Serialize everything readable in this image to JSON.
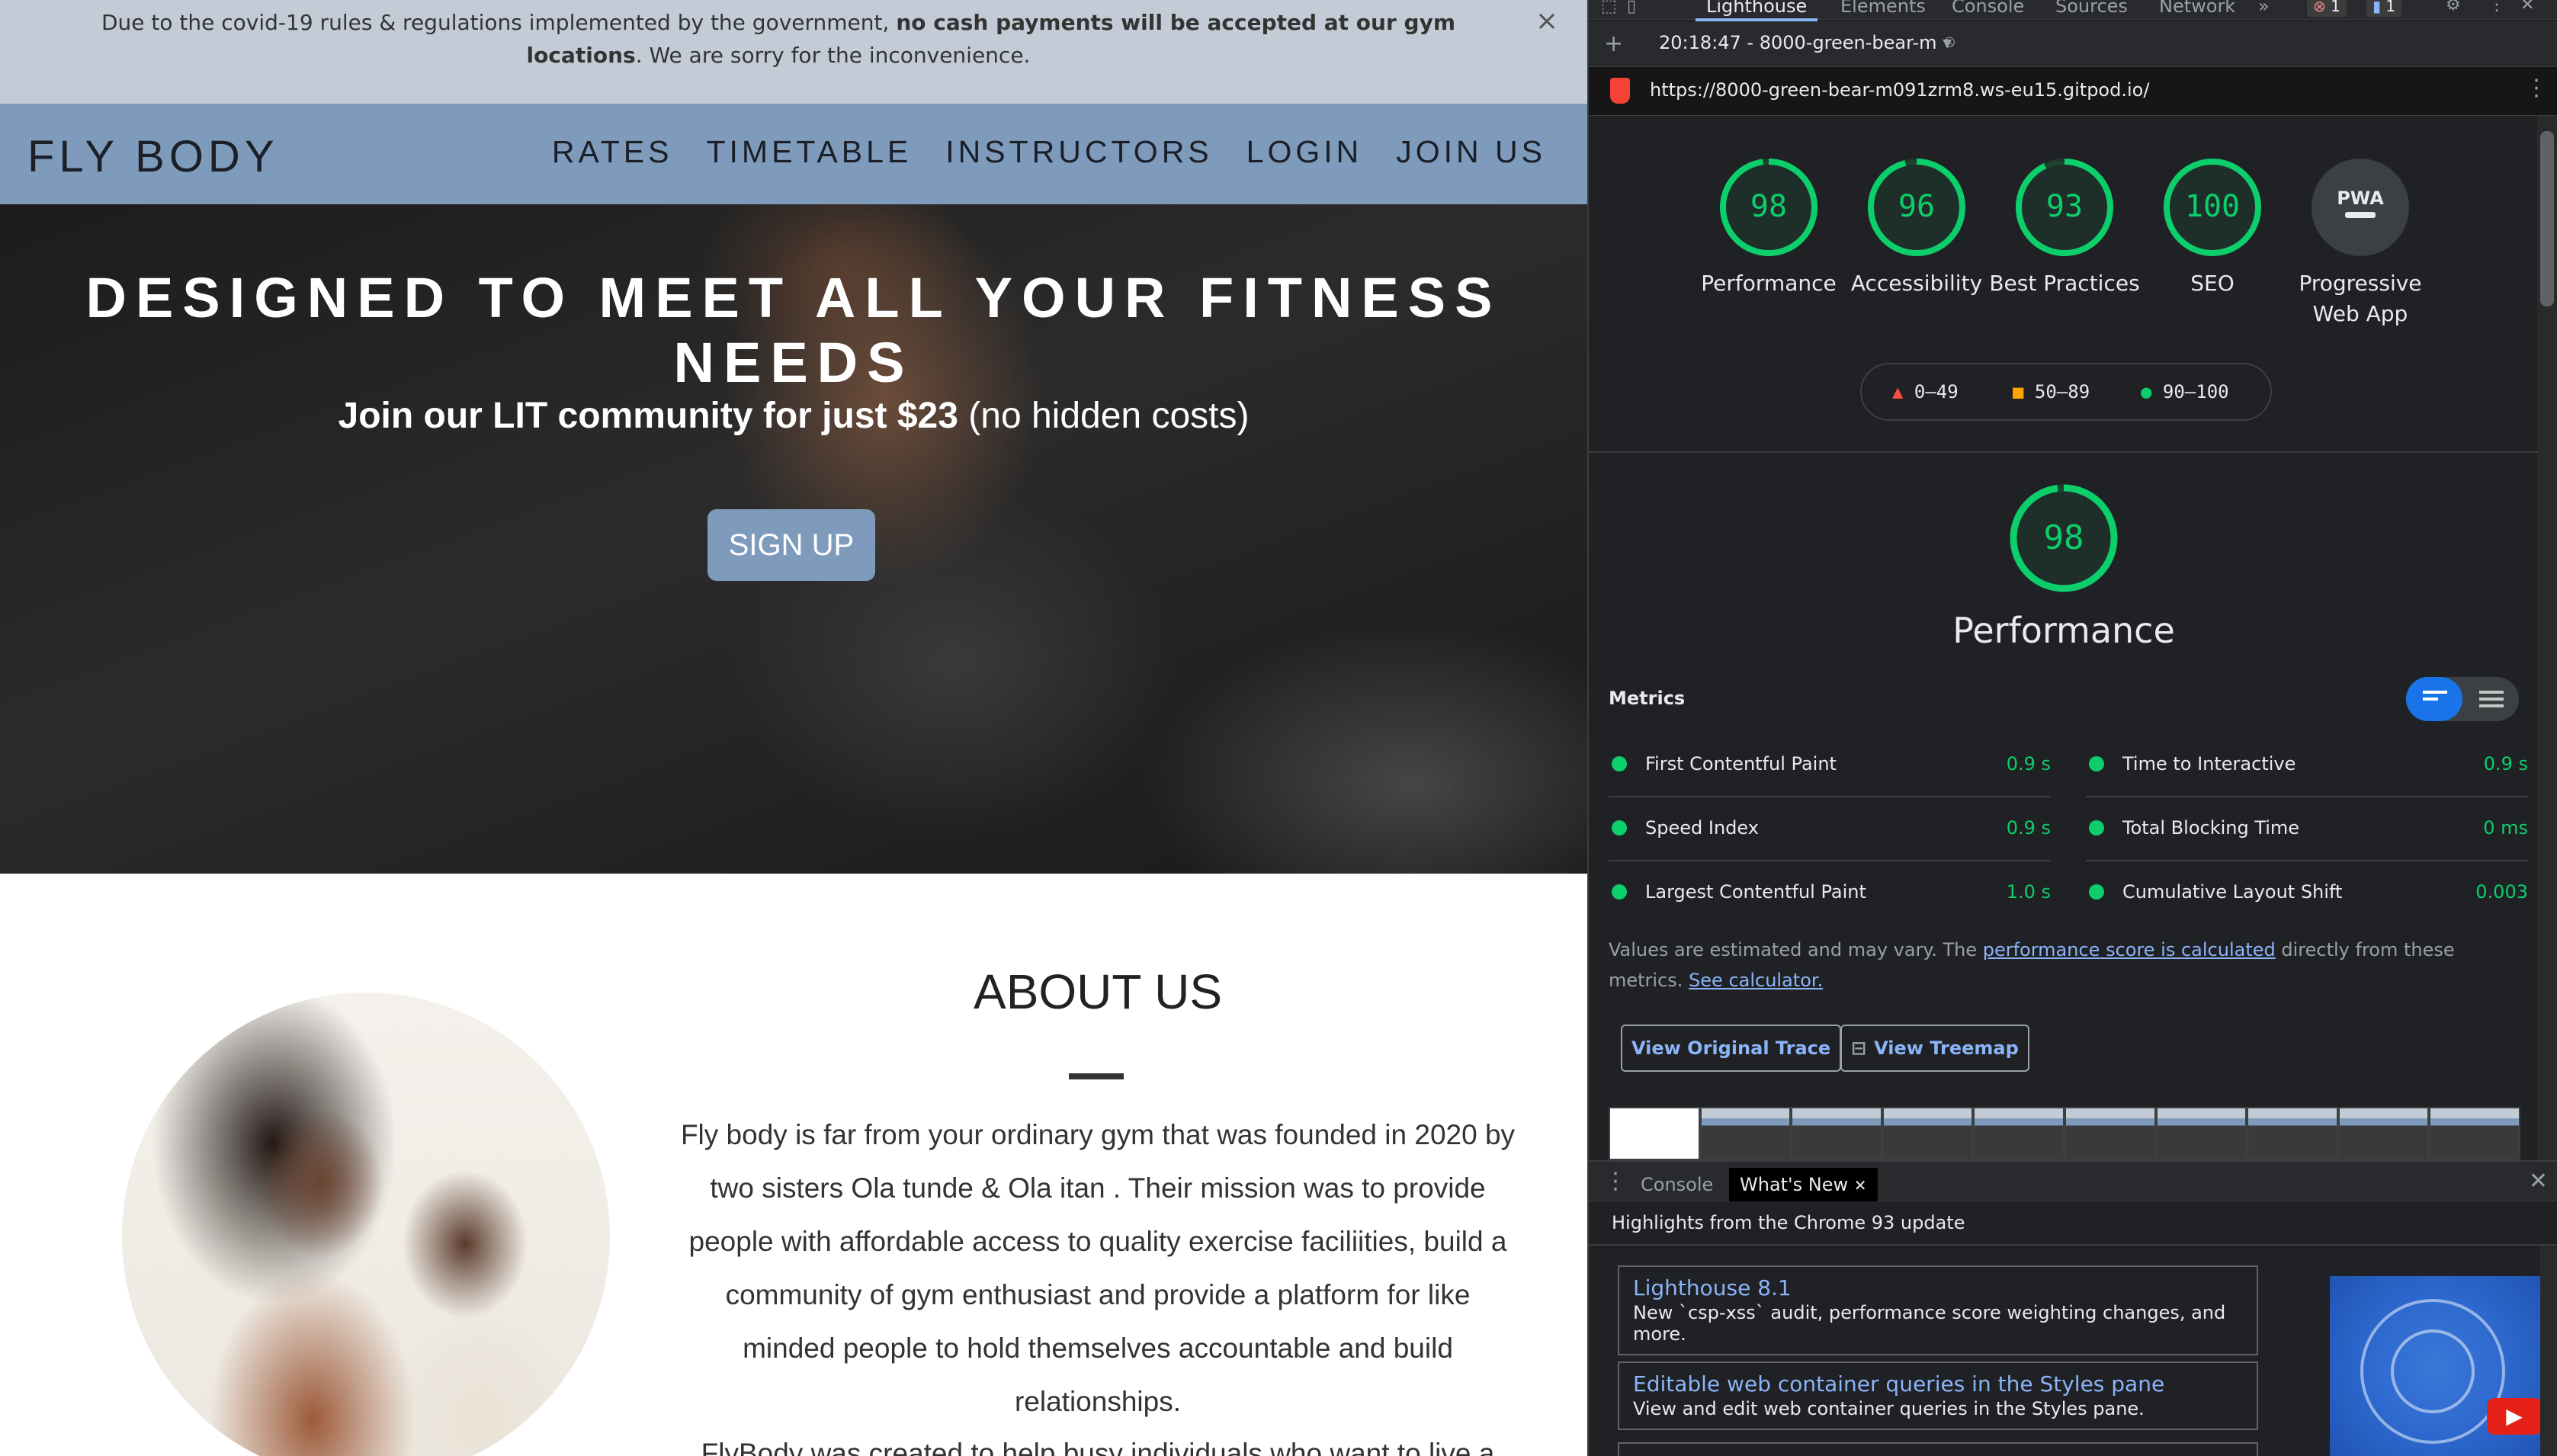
{
  "site": {
    "banner": {
      "text_before": "Due to the covid-19 rules & regulations implemented by the government, ",
      "text_bold": "no cash payments will be accepted at our gym locations",
      "text_after": ". We are sorry for the inconvenience.",
      "close_label": "×"
    },
    "nav": {
      "brand": "FLY BODY",
      "links": [
        "RATES",
        "TIMETABLE",
        "INSTRUCTORS",
        "LOGIN",
        "JOIN US"
      ]
    },
    "hero": {
      "title": "DESIGNED TO MEET ALL YOUR FITNESS NEEDS",
      "subtitle_bold": "Join our LIT community for just $23",
      "subtitle_rest": " (no hidden costs)",
      "cta": "SIGN UP"
    },
    "about": {
      "title": "ABOUT US",
      "paragraph1": "Fly body is far from your ordinary gym that was founded in 2020 by two sisters Ola tunde & Ola itan . Their mission was to provide people with affordable access to quality exercise faciliities, build a community of gym enthusiast and provide a platform for like minded people to hold themselves accountable and build relationships.",
      "paragraph2": "FlyBody was created to help busy individuals who want to live a"
    }
  },
  "devtools": {
    "tabs": [
      "Lighthouse",
      "Elements",
      "Console",
      "Sources",
      "Network"
    ],
    "more_tabs": "»",
    "error_count": "1",
    "message_count": "1",
    "report_select": "20:18:47 - 8000-green-bear-m",
    "url": "https://8000-green-bear-m091zrm8.ws-eu15.gitpod.io/",
    "categories": [
      {
        "label": "Performance",
        "score": "98",
        "fraction": 0.98
      },
      {
        "label": "Accessibility",
        "score": "96",
        "fraction": 0.96
      },
      {
        "label": "Best Practices",
        "score": "93",
        "fraction": 0.93
      },
      {
        "label": "SEO",
        "score": "100",
        "fraction": 1.0
      },
      {
        "label": "Progressive Web App",
        "score": "PWA",
        "fraction": 0
      }
    ],
    "legend": {
      "fail": "0–49",
      "average": "50–89",
      "pass": "90–100"
    },
    "performance": {
      "score": "98",
      "fraction": 0.98,
      "title": "Performance"
    },
    "metrics_title": "Metrics",
    "metrics": [
      {
        "name": "First Contentful Paint",
        "value": "0.9 s"
      },
      {
        "name": "Time to Interactive",
        "value": "0.9 s"
      },
      {
        "name": "Speed Index",
        "value": "0.9 s"
      },
      {
        "name": "Total Blocking Time",
        "value": "0 ms"
      },
      {
        "name": "Largest Contentful Paint",
        "value": "1.0 s"
      },
      {
        "name": "Cumulative Layout Shift",
        "value": "0.003"
      }
    ],
    "disclaimer": {
      "text1": "Values are estimated and may vary. The ",
      "link1": "performance score is calculated",
      "text2": " directly from these metrics. ",
      "link2": "See calculator."
    },
    "buttons": {
      "trace": "View Original Trace",
      "treemap": "View Treemap"
    },
    "drawer": {
      "tabs": [
        "Console",
        "What's New"
      ],
      "subtitle": "Highlights from the Chrome 93 update",
      "news": [
        {
          "title": "Lighthouse 8.1",
          "desc": "New `csp-xss` audit, performance score weighting changes, and more."
        },
        {
          "title": "Editable web container queries in the Styles pane",
          "desc": "View and edit web container queries in the Styles pane."
        }
      ]
    },
    "colors": {
      "pass": "#0cce6b",
      "average": "#ffa400",
      "fail": "#ff4e42",
      "accent": "#8ab4f8"
    }
  }
}
